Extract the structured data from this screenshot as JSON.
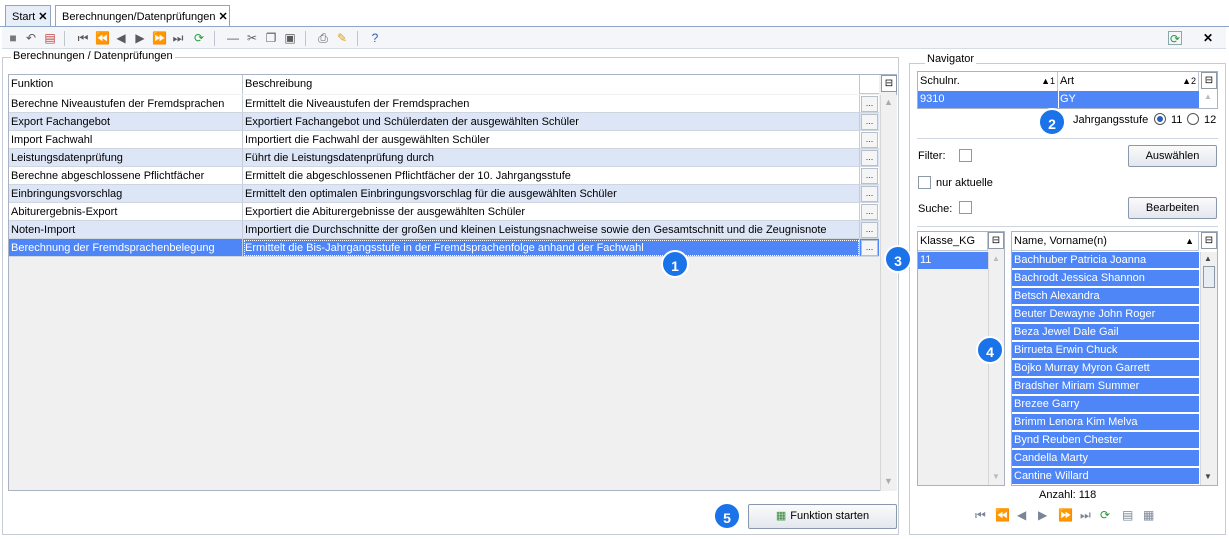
{
  "tabs": [
    {
      "label": "Start"
    },
    {
      "label": "Berechnungen/Datenprüfungen"
    }
  ],
  "left": {
    "group_title": "Berechnungen / Datenprüfungen",
    "columns": [
      "Funktion",
      "Beschreibung"
    ],
    "rows": [
      {
        "funktion": "Berechne Niveaustufen der Fremdsprachen",
        "beschreibung": "Ermittelt die Niveaustufen der Fremdsprachen"
      },
      {
        "funktion": "Export Fachangebot",
        "beschreibung": "Exportiert Fachangebot und Schülerdaten der ausgewählten Schüler"
      },
      {
        "funktion": "Import Fachwahl",
        "beschreibung": "Importiert die Fachwahl der ausgewählten Schüler"
      },
      {
        "funktion": "Leistungsdatenprüfung",
        "beschreibung": "Führt die Leistungsdatenprüfung durch"
      },
      {
        "funktion": "Berechne abgeschlossene Pflichtfächer",
        "beschreibung": "Ermittelt die abgeschlossenen Pflichtfächer der 10. Jahrgangsstufe"
      },
      {
        "funktion": "Einbringungsvorschlag",
        "beschreibung": "Ermittelt den optimalen Einbringungsvorschlag für die ausgewählten Schüler"
      },
      {
        "funktion": "Abiturergebnis-Export",
        "beschreibung": "Exportiert die Abiturergebnisse der ausgewählten Schüler"
      },
      {
        "funktion": "Noten-Import",
        "beschreibung": "Importiert die Durchschnitte der großen und kleinen Leistungsnachweise sowie den Gesamtschnitt und die Zeugnisnote"
      },
      {
        "funktion": "Berechnung der Fremdsprachenbelegung",
        "beschreibung": "Ermittelt die Bis-Jahrgangsstufe in der Fremdsprachenfolge anhand der Fachwahl"
      }
    ],
    "dots_label": "...",
    "start_button": "Funktion starten"
  },
  "navigator": {
    "title": "Navigator",
    "col_schulnr": "Schulnr.",
    "col_schulnr_sort": "▲1",
    "col_art": "Art",
    "col_art_sort": "▲2",
    "schulnr": "9310",
    "art": "GY",
    "jahrgangsstufe_label": "Jahrgangsstufe",
    "radio_11": "11",
    "radio_12": "12",
    "filter_label": "Filter:",
    "auswaehlen": "Auswählen",
    "nur_aktuelle": "nur aktuelle",
    "suche_label": "Suche:",
    "bearbeiten": "Bearbeiten",
    "col_klasse": "Klasse_KG",
    "klasse_value": "11",
    "col_name": "Name, Vorname(n)",
    "names": [
      "Bachhuber Patricia Joanna",
      "Bachrodt Jessica Shannon",
      "Betsch Alexandra",
      "Beuter Dewayne John Roger",
      "Beza Jewel Dale Gail",
      "Birrueta Erwin Chuck",
      "Bojko Murray Myron Garrett",
      "Bradsher Miriam Summer",
      "Brezee Garry",
      "Brimm Lenora Kim Melva",
      "Bynd Reuben Chester",
      "Candella Marty",
      "Cantine Willard"
    ],
    "anzahl": "Anzahl: 118"
  },
  "badges": [
    "1",
    "2",
    "3",
    "4",
    "5"
  ],
  "colors": {
    "selection": "#4f86f7",
    "row_alt": "#dde6f7",
    "badge": "#1a73e8"
  }
}
